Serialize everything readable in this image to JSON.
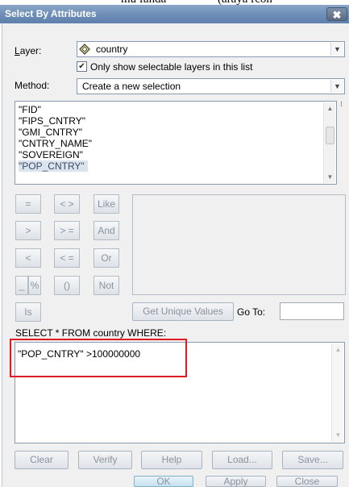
{
  "background_text": "(araya rcon",
  "background_text_left": "mu fanda",
  "dialog": {
    "title": "Select By Attributes",
    "close_glyph": "✖"
  },
  "layer": {
    "label": "Layer:",
    "label_accel": "L",
    "value": "country",
    "only_selectable_checked": true,
    "only_selectable_label": "Only show selectable layers in this list"
  },
  "method": {
    "label": "Method:",
    "value": "Create a new selection"
  },
  "fields": [
    "\"FID\"",
    "\"FIPS_CNTRY\"",
    "\"GMI_CNTRY\"",
    "\"CNTRY_NAME\"",
    "\"SOVEREIGN\"",
    "\"POP_CNTRY\""
  ],
  "selected_field_index": 5,
  "operators": {
    "eq": "=",
    "ne": "< >",
    "like": "Like",
    "gt": ">",
    "ge": "> =",
    "and": "And",
    "lt": "<",
    "le": "< =",
    "or": "Or",
    "underscore": "_",
    "percent": "%",
    "parens": "()",
    "not": "Not",
    "is": "Is"
  },
  "get_unique_values_label": "Get Unique Values",
  "go_to_label": "Go To:",
  "go_to_value": "",
  "sql_prefix": "SELECT * FROM country WHERE:",
  "expression": "\"POP_CNTRY\" >100000000",
  "buttons": {
    "clear": "Clear",
    "verify": "Verify",
    "help": "Help",
    "load": "Load...",
    "save": "Save...",
    "ok": "OK",
    "apply": "Apply",
    "close": "Close"
  }
}
